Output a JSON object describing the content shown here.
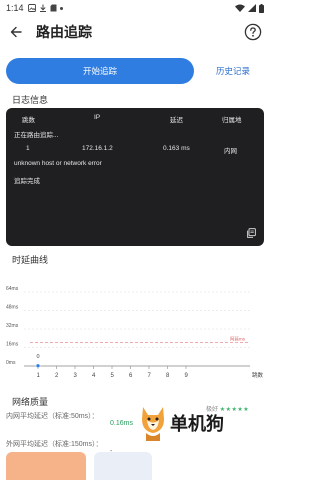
{
  "status": {
    "time": "1:14"
  },
  "appbar": {
    "title": "路由追踪"
  },
  "actions": {
    "start_label": "开始追踪",
    "history_label": "历史记录"
  },
  "log": {
    "section_title": "日志信息",
    "headers": [
      "跳数",
      "IP",
      "延迟",
      "归属地"
    ],
    "rows": [
      {
        "hop": "1",
        "ip": "172.16.1.2",
        "delay": "0.163 ms",
        "location": "内网"
      }
    ],
    "lines": {
      "tracing": "正在路由追踪...",
      "error": "unknown host or network error",
      "done": "追踪完成"
    }
  },
  "chart_section_title": "时延曲线",
  "chart_data": {
    "type": "line",
    "ytick_labels": [
      "64ms",
      "48ms",
      "32ms",
      "16ms",
      "0ms"
    ],
    "yticks": [
      64,
      48,
      32,
      16,
      0
    ],
    "ylim": [
      0,
      64
    ],
    "xticks": [
      "1",
      "2",
      "3",
      "4",
      "5",
      "6",
      "7",
      "8",
      "9"
    ],
    "xlabel": "跳数",
    "x": [
      1
    ],
    "y": [
      0.163
    ],
    "point_labels": [
      "0"
    ],
    "threshold": {
      "value": 16,
      "label": "阿延ms"
    }
  },
  "quality": {
    "section_title": "网络质量",
    "intranet_label": "内网平均延迟（标准:50ms）：",
    "intranet_value": "0.16ms",
    "extranet_label": "外网平均延迟（标准:150ms）：",
    "extranet_value": "-",
    "rating_label": "极好",
    "rating_stars": "★★★★★"
  },
  "watermark": {
    "text": "单机狗"
  },
  "colors": {
    "accent": "#2f7de1",
    "panel": "#1f1f22",
    "good": "#2a9d5c",
    "threshold": "#e05a5a"
  }
}
